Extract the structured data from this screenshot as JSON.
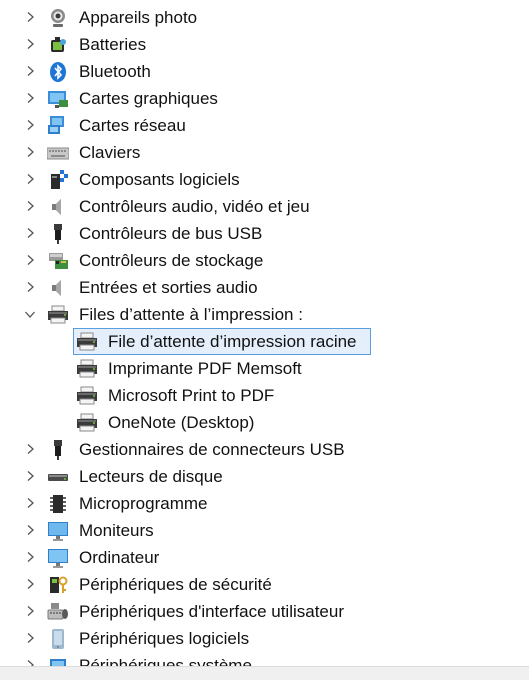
{
  "tree": {
    "items": [
      {
        "label": "Appareils photo",
        "icon": "camera-icon",
        "expanded": false
      },
      {
        "label": "Batteries",
        "icon": "battery-icon",
        "expanded": false
      },
      {
        "label": "Bluetooth",
        "icon": "bluetooth-icon",
        "expanded": false
      },
      {
        "label": "Cartes graphiques",
        "icon": "display-adapter-icon",
        "expanded": false
      },
      {
        "label": "Cartes réseau",
        "icon": "network-adapter-icon",
        "expanded": false
      },
      {
        "label": "Claviers",
        "icon": "keyboard-icon",
        "expanded": false
      },
      {
        "label": "Composants logiciels",
        "icon": "software-component-icon",
        "expanded": false
      },
      {
        "label": "Contrôleurs audio, vidéo et jeu",
        "icon": "speaker-icon",
        "expanded": false
      },
      {
        "label": "Contrôleurs de bus USB",
        "icon": "usb-icon",
        "expanded": false
      },
      {
        "label": "Contrôleurs de stockage",
        "icon": "storage-controller-icon",
        "expanded": false
      },
      {
        "label": "Entrées et sorties audio",
        "icon": "speaker-icon",
        "expanded": false
      },
      {
        "label": "Files d’attente à l’impression :",
        "icon": "printer-icon",
        "expanded": true,
        "children": [
          {
            "label": "File d’attente d’impression racine",
            "icon": "printer-icon",
            "selected": true
          },
          {
            "label": "Imprimante PDF Memsoft",
            "icon": "printer-icon"
          },
          {
            "label": "Microsoft Print to PDF",
            "icon": "printer-icon"
          },
          {
            "label": "OneNote (Desktop)",
            "icon": "printer-icon"
          }
        ]
      },
      {
        "label": "Gestionnaires de connecteurs USB",
        "icon": "usb-icon",
        "expanded": false
      },
      {
        "label": "Lecteurs de disque",
        "icon": "disk-drive-icon",
        "expanded": false
      },
      {
        "label": "Microprogramme",
        "icon": "firmware-chip-icon",
        "expanded": false
      },
      {
        "label": "Moniteurs",
        "icon": "monitor-icon",
        "expanded": false
      },
      {
        "label": "Ordinateur",
        "icon": "computer-icon",
        "expanded": false
      },
      {
        "label": "Périphériques de sécurité",
        "icon": "security-key-icon",
        "expanded": false
      },
      {
        "label": "Périphériques d'interface utilisateur",
        "icon": "hid-icon",
        "expanded": false
      },
      {
        "label": "Périphériques logiciels",
        "icon": "software-device-icon",
        "expanded": false
      },
      {
        "label": "Périphériques système",
        "icon": "system-device-icon",
        "expanded": false
      }
    ]
  },
  "colors": {
    "text": "#111111",
    "selection_border": "#5a9ee0",
    "selection_fill": "#e4effb",
    "chevron": "#555555"
  }
}
